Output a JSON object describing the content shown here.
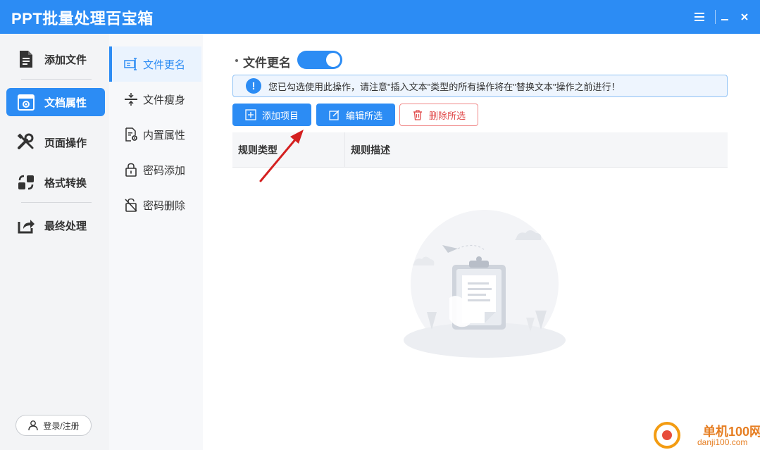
{
  "app": {
    "title": "PPT批量处理百宝箱"
  },
  "left_nav": {
    "items": [
      {
        "label": "添加文件",
        "icon": "file-add-icon",
        "active": false
      },
      {
        "label": "文档属性",
        "icon": "doc-settings-icon",
        "active": true
      },
      {
        "label": "页面操作",
        "icon": "tools-icon",
        "active": false
      },
      {
        "label": "格式转换",
        "icon": "format-convert-icon",
        "active": false
      },
      {
        "label": "最终处理",
        "icon": "export-share-icon",
        "active": false
      }
    ],
    "login_label": "登录/注册"
  },
  "sub_nav": {
    "items": [
      {
        "label": "文件更名",
        "icon": "rename-icon",
        "active": true
      },
      {
        "label": "文件瘦身",
        "icon": "compress-icon",
        "active": false
      },
      {
        "label": "内置属性",
        "icon": "doc-props-icon",
        "active": false
      },
      {
        "label": "密码添加",
        "icon": "lock-icon",
        "active": false
      },
      {
        "label": "密码删除",
        "icon": "unlock-icon",
        "active": false
      }
    ]
  },
  "main": {
    "section_title": "文件更名",
    "toggle_on": true,
    "notice": "您已勾选使用此操作，请注意\"插入文本\"类型的所有操作将在\"替换文本\"操作之前进行！",
    "buttons": {
      "add": "添加项目",
      "edit": "编辑所选",
      "delete": "删除所选"
    },
    "table": {
      "columns": [
        "规则类型",
        "规则描述"
      ],
      "rows": []
    }
  },
  "watermark": {
    "cn": "单机100网",
    "en": "danji100.com"
  },
  "colors": {
    "accent": "#2c8cf4",
    "danger": "#e04a4a",
    "arrow": "#d42020"
  }
}
